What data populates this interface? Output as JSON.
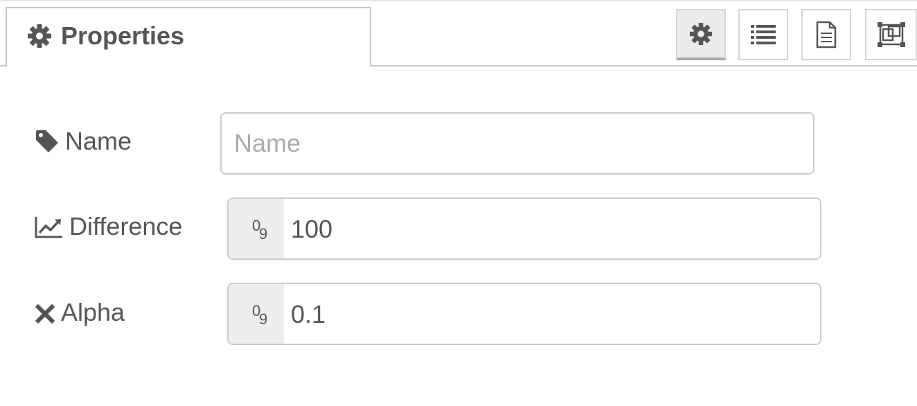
{
  "tabs": {
    "properties_label": "Properties"
  },
  "toolbar": {
    "buttons": [
      {
        "icon": "gear-icon",
        "selected": true
      },
      {
        "icon": "list-icon",
        "selected": false
      },
      {
        "icon": "document-icon",
        "selected": false
      },
      {
        "icon": "frame-icon",
        "selected": false
      }
    ]
  },
  "form": {
    "name": {
      "label": "Name",
      "placeholder": "Name",
      "value": "",
      "icon": "tag-icon"
    },
    "difference": {
      "label": "Difference",
      "type_digit_top": "0",
      "type_digit_bottom": "9",
      "value": "100",
      "icon": "line-chart-icon"
    },
    "alpha": {
      "label": "Alpha",
      "type_digit_top": "0",
      "type_digit_bottom": "9",
      "value": "0.1",
      "icon": "times-icon"
    }
  },
  "colors": {
    "text": "#555555",
    "border": "#cccccc",
    "type_select_bg": "#eeeeee",
    "selected_tab_bg": "#ebebeb"
  }
}
